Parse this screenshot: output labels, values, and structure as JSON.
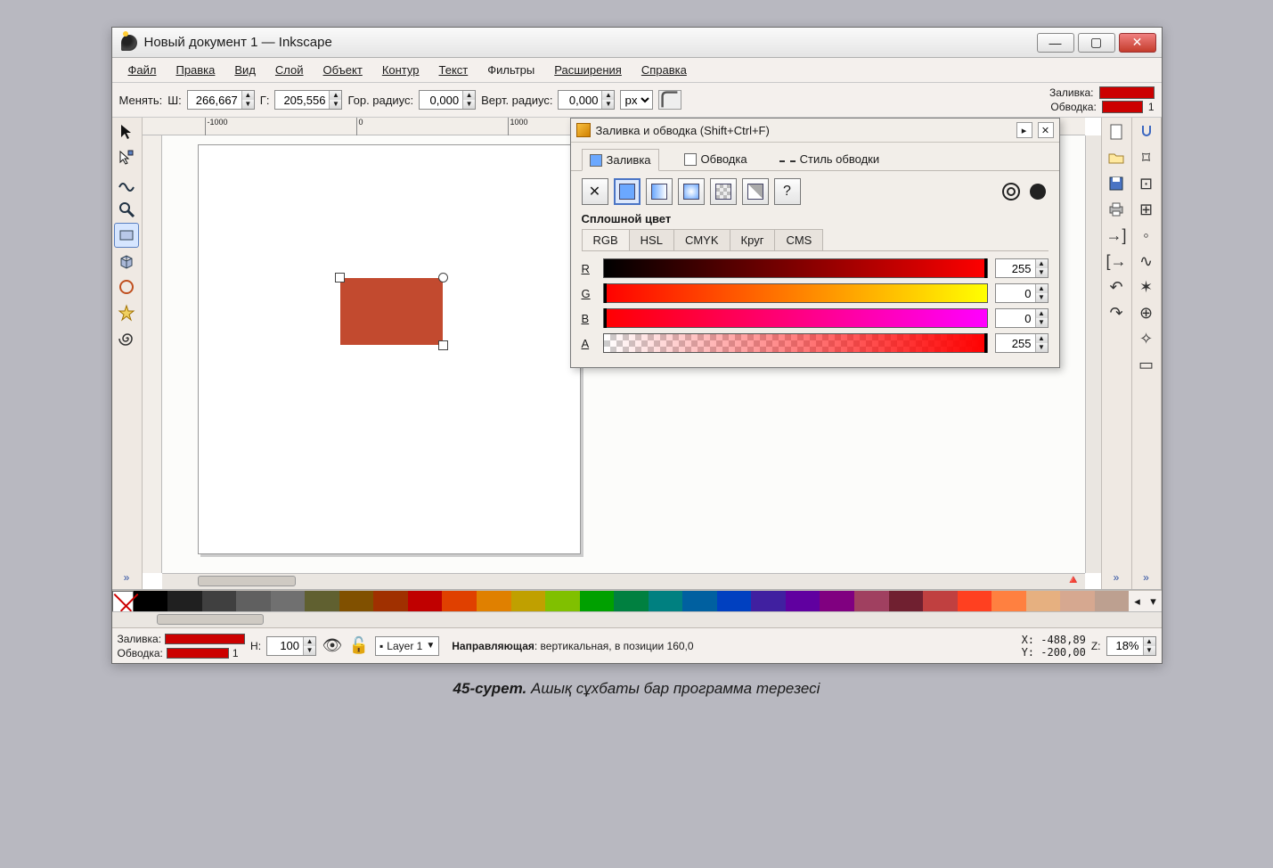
{
  "title": "Новый документ 1 — Inkscape",
  "menu": [
    "Файл",
    "Правка",
    "Вид",
    "Слой",
    "Объект",
    "Контур",
    "Текст",
    "Фильтры",
    "Расширения",
    "Справка"
  ],
  "opt": {
    "change": "Менять:",
    "w_label": "Ш:",
    "w": "266,667",
    "h_label": "Г:",
    "h": "205,556",
    "rx_label": "Гор. радиус:",
    "rx": "0,000",
    "ry_label": "Верт. радиус:",
    "ry": "0,000",
    "unit": "px",
    "fill_label": "Заливка:",
    "stroke_label": "Обводка:",
    "stroke_w": "1"
  },
  "ruler": {
    "t1": "-1000",
    "t2": "0",
    "t3": "1000"
  },
  "dialog": {
    "title": "Заливка и обводка (Shift+Ctrl+F)",
    "tab_fill": "Заливка",
    "tab_stroke": "Обводка",
    "tab_style": "Стиль обводки",
    "section": "Сплошной цвет",
    "ctabs": [
      "RGB",
      "HSL",
      "CMYK",
      "Круг",
      "CMS"
    ],
    "r_label": "R",
    "r": "255",
    "g_label": "G",
    "g": "0",
    "b_label": "B",
    "b": "0",
    "a_label": "A",
    "a": "255"
  },
  "palette": [
    "#000000",
    "#202020",
    "#404040",
    "#606060",
    "#707070",
    "#606030",
    "#805000",
    "#a03000",
    "#c00000",
    "#e04000",
    "#e08000",
    "#c0a000",
    "#80c000",
    "#00a000",
    "#008040",
    "#008080",
    "#0060a0",
    "#0040c0",
    "#4020a0",
    "#6000a0",
    "#800080",
    "#a04060",
    "#702030",
    "#c04040",
    "#ff4020",
    "#ff8040",
    "#e6b080",
    "#d6a890",
    "#bda090"
  ],
  "status": {
    "fill_label": "Заливка:",
    "stroke_label": "Обводка:",
    "stroke_w": "1",
    "opacity": "100",
    "layer": "Layer 1",
    "hint_b": "Направляющая",
    "hint_rest": ": вертикальная, в позиции 160,0",
    "x": "X: -488,89",
    "y": "Y: -200,00",
    "z_label": "Z:",
    "zoom": "18%"
  },
  "caption_b": "45-сурет.",
  "caption_i": "Ашық сұхбаты бар программа терезесі"
}
